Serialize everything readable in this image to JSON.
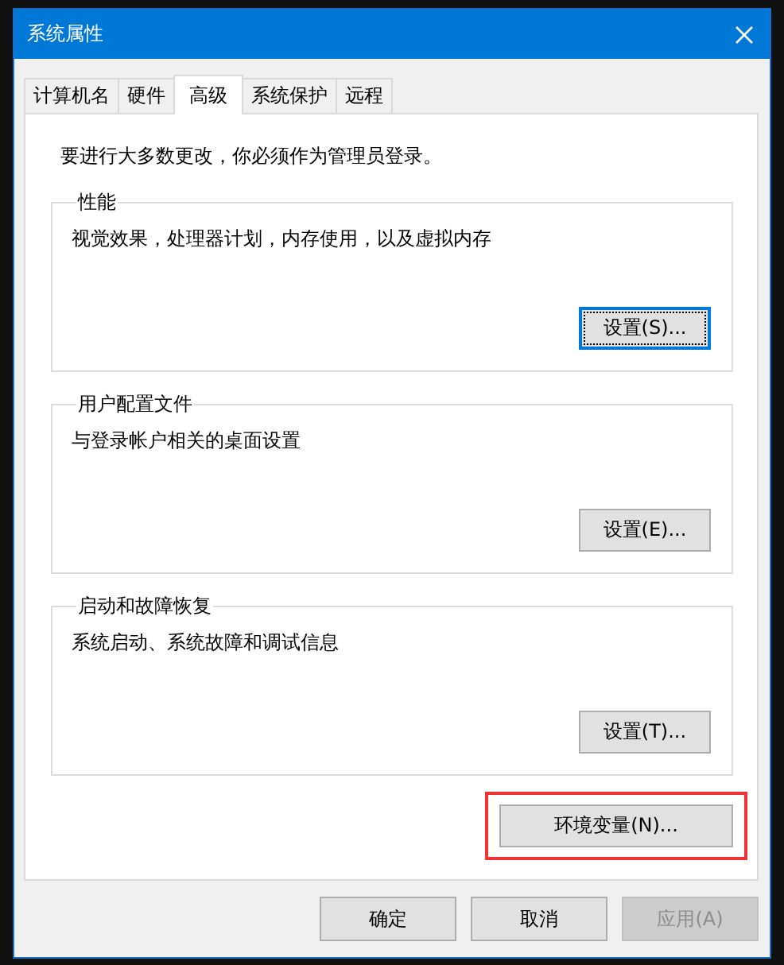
{
  "window": {
    "title": "系统属性"
  },
  "tabs": [
    {
      "label": "计算机名",
      "selected": false
    },
    {
      "label": "硬件",
      "selected": false
    },
    {
      "label": "高级",
      "selected": true
    },
    {
      "label": "系统保护",
      "selected": false
    },
    {
      "label": "远程",
      "selected": false
    }
  ],
  "notice": "要进行大多数更改，你必须作为管理员登录。",
  "groups": [
    {
      "title": "性能",
      "description": "视觉效果，处理器计划，内存使用，以及虚拟内存",
      "button": {
        "label": "设置(S)...",
        "focused": true
      }
    },
    {
      "title": "用户配置文件",
      "description": "与登录帐户相关的桌面设置",
      "button": {
        "label": "设置(E)...",
        "focused": false
      }
    },
    {
      "title": "启动和故障恢复",
      "description": "系统启动、系统故障和调试信息",
      "button": {
        "label": "设置(T)...",
        "focused": false
      }
    }
  ],
  "env_button": {
    "label": "环境变量(N)...",
    "highlighted": true
  },
  "buttons": [
    {
      "label": "确定",
      "disabled": false
    },
    {
      "label": "取消",
      "disabled": false
    },
    {
      "label": "应用(A)",
      "disabled": true
    }
  ]
}
